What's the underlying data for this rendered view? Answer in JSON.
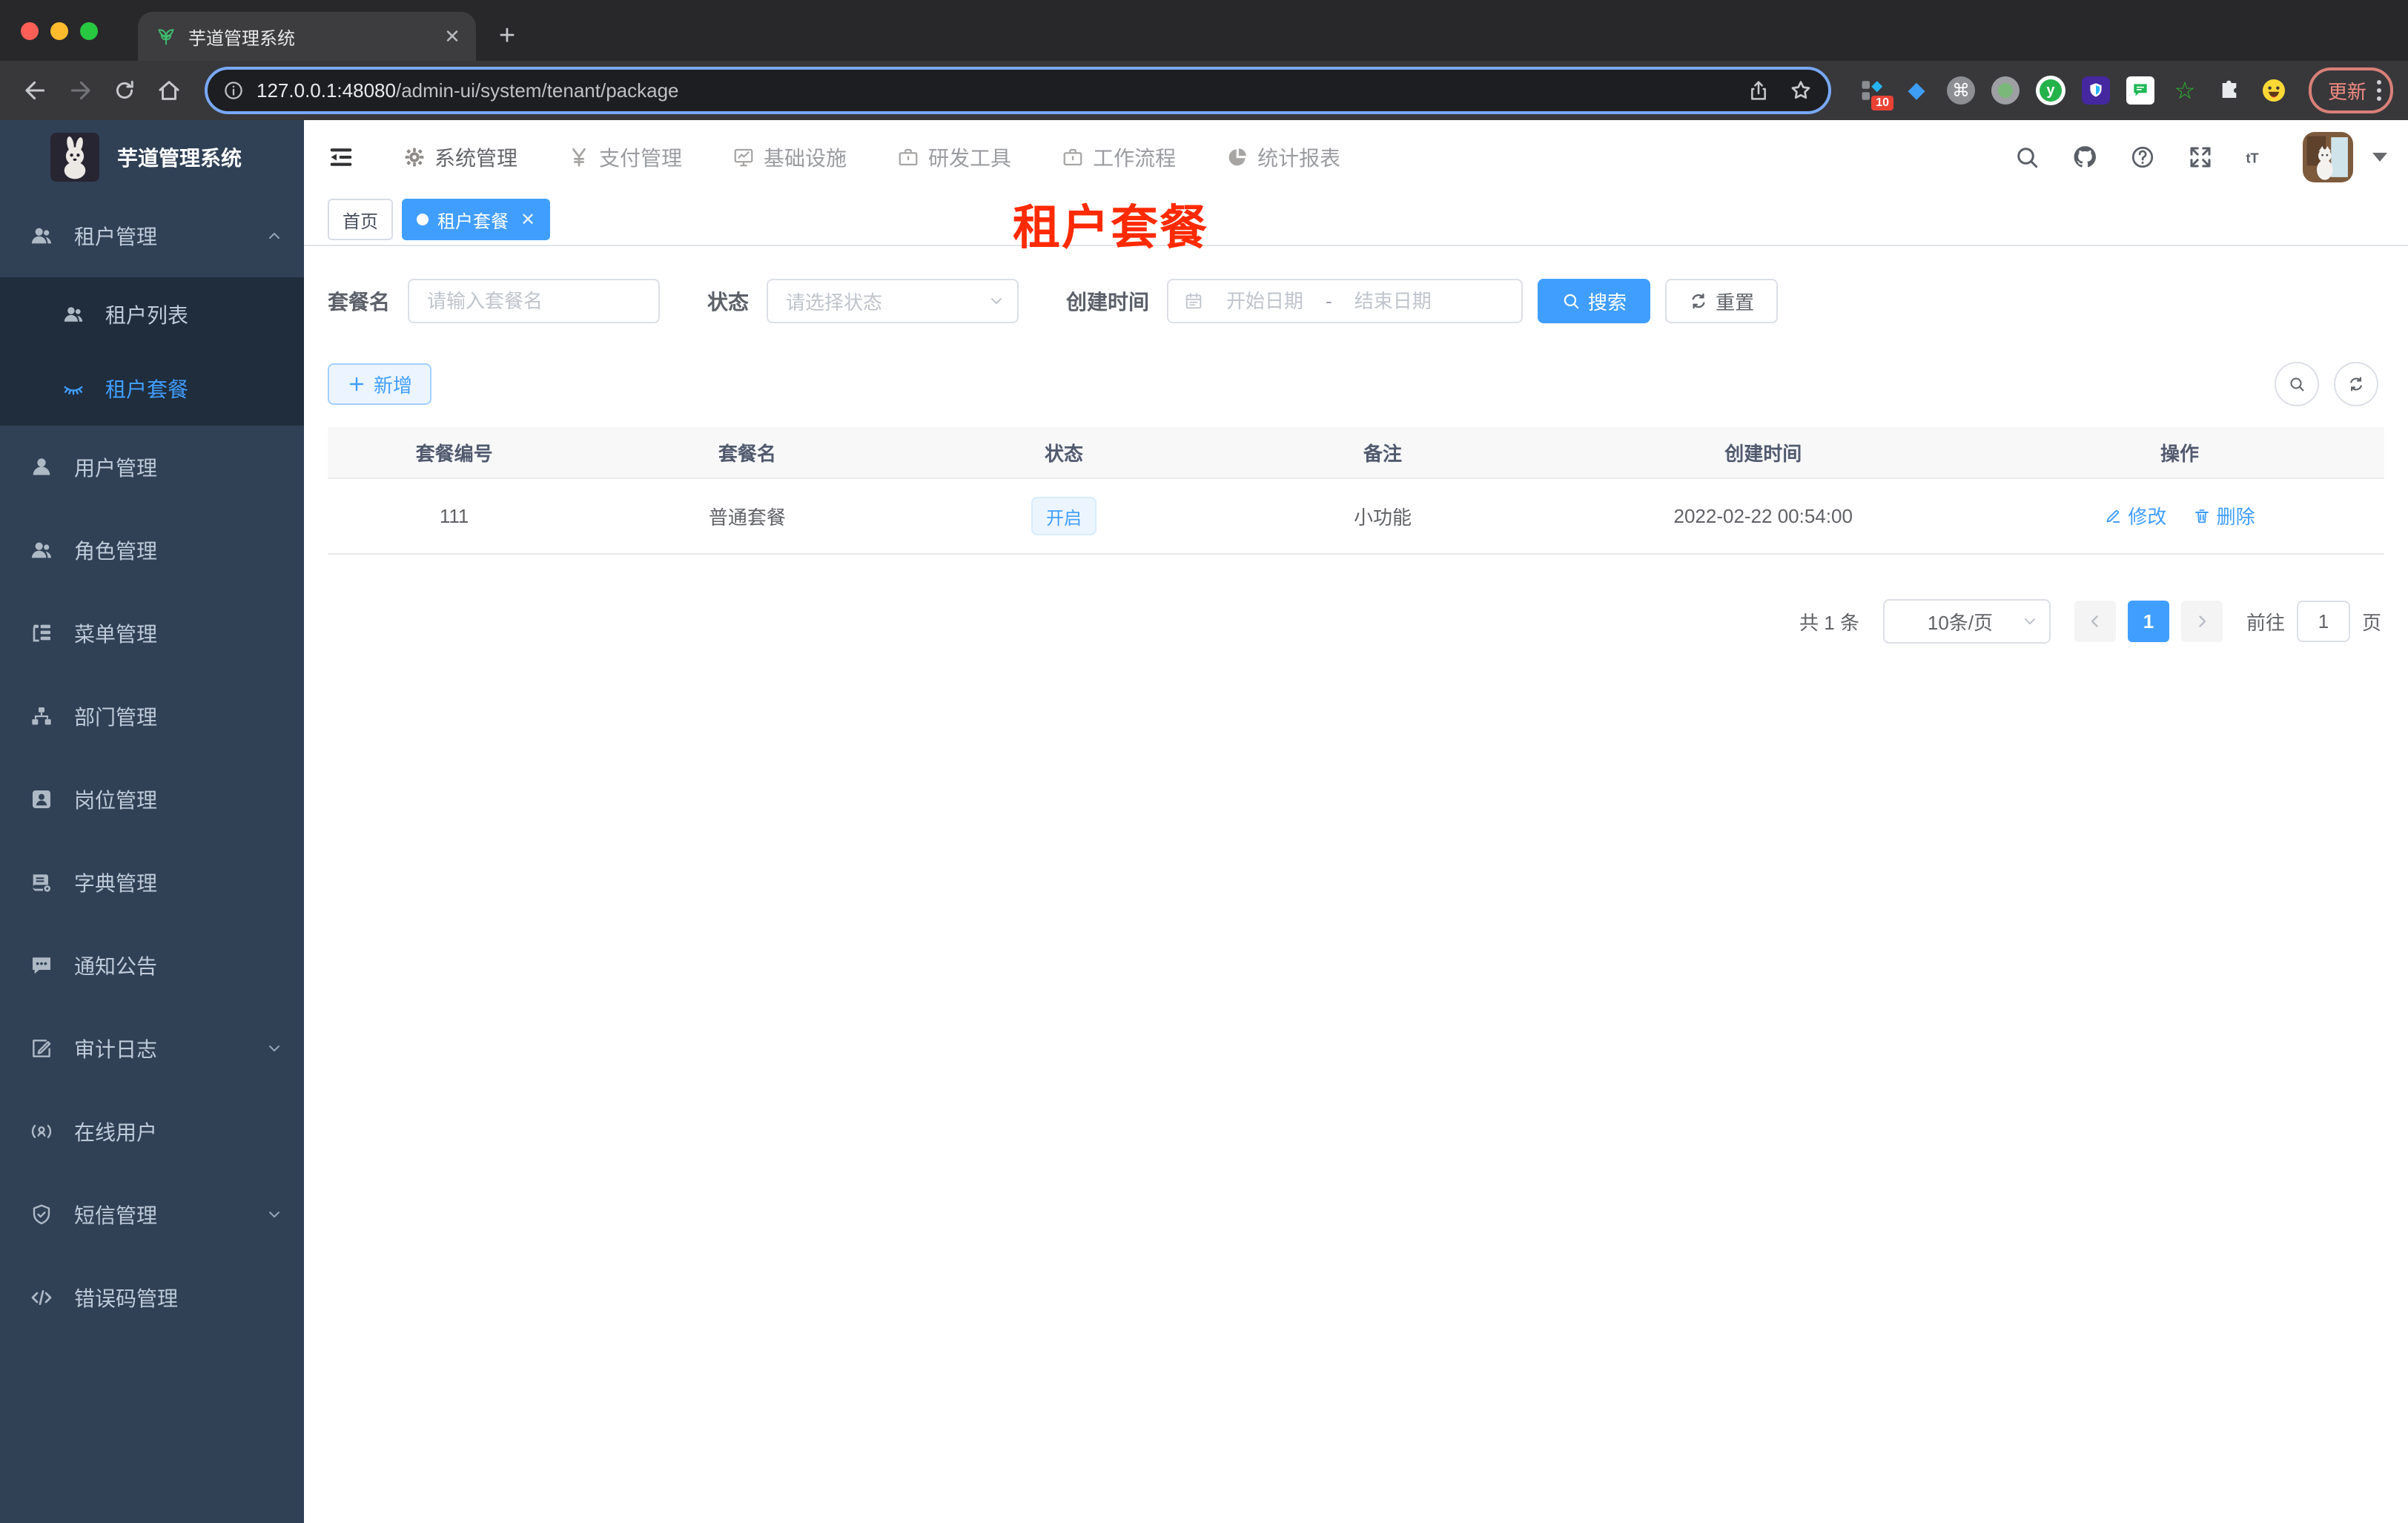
{
  "browser": {
    "tab_title": "芋道管理系统",
    "url_host": "127.0.0.1:48080",
    "url_path": "/admin-ui/system/tenant/package",
    "ext_badge": "10",
    "ext_y_label": "y",
    "ext_cmd_glyph": "⌘",
    "ext_gem_glyph": "◆",
    "ext_star_glyph": "☆",
    "update_label": "更新",
    "new_tab_glyph": "+",
    "tab_close_glyph": "✕"
  },
  "header": {
    "logo_title": "芋道管理系统",
    "menus": [
      {
        "label": "系统管理"
      },
      {
        "label": "支付管理"
      },
      {
        "label": "基础设施"
      },
      {
        "label": "研发工具"
      },
      {
        "label": "工作流程"
      },
      {
        "label": "统计报表"
      }
    ]
  },
  "sidebar": {
    "tenant_group": {
      "label": "租户管理"
    },
    "tenant_children": [
      {
        "label": "租户列表"
      },
      {
        "label": "租户套餐"
      }
    ],
    "items": [
      {
        "label": "用户管理"
      },
      {
        "label": "角色管理"
      },
      {
        "label": "菜单管理"
      },
      {
        "label": "部门管理"
      },
      {
        "label": "岗位管理"
      },
      {
        "label": "字典管理"
      },
      {
        "label": "通知公告"
      },
      {
        "label": "审计日志"
      },
      {
        "label": "在线用户"
      },
      {
        "label": "短信管理"
      },
      {
        "label": "错误码管理"
      }
    ]
  },
  "tags": {
    "home": "首页",
    "active": "租户套餐",
    "close_glyph": "✕"
  },
  "overlay_title": "租户套餐",
  "filters": {
    "name_label": "套餐名",
    "name_placeholder": "请输入套餐名",
    "status_label": "状态",
    "status_placeholder": "请选择状态",
    "date_label": "创建时间",
    "date_start_placeholder": "开始日期",
    "date_separator": "-",
    "date_end_placeholder": "结束日期",
    "search_label": "搜索",
    "reset_label": "重置"
  },
  "toolbar": {
    "add_label": "新增"
  },
  "table": {
    "columns": [
      "套餐编号",
      "套餐名",
      "状态",
      "备注",
      "创建时间",
      "操作"
    ],
    "row": {
      "id": "111",
      "name": "普通套餐",
      "status": "开启",
      "remark": "小功能",
      "created": "2022-02-22 00:54:00",
      "edit": "修改",
      "delete": "删除"
    }
  },
  "pagination": {
    "total": "共 1 条",
    "size": "10条/页",
    "page": "1",
    "goto_label": "前往",
    "goto_value": "1",
    "unit": "页"
  },
  "colors": {
    "accent": "#409eff",
    "annotation_red": "#ff2a00",
    "sidebar_bg": "#304156",
    "submenu_bg": "#1f2d3d"
  }
}
